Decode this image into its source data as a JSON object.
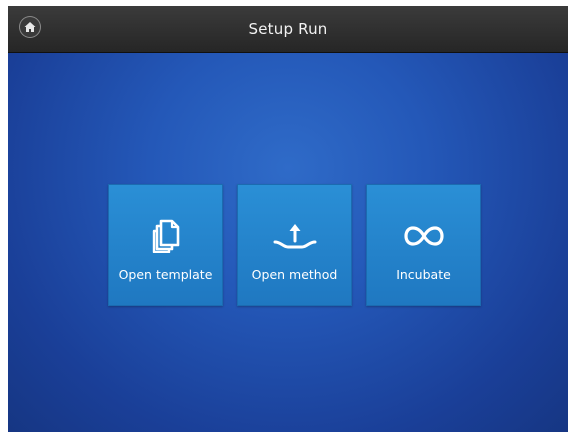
{
  "window": {
    "title": "Setup Run",
    "home_icon": "home-icon"
  },
  "tiles": [
    {
      "label": "Open template",
      "icon": "copy-documents-icon"
    },
    {
      "label": "Open method",
      "icon": "upload-arrow-icon"
    },
    {
      "label": "Incubate",
      "icon": "infinity-icon"
    }
  ],
  "colors": {
    "background": "#1f4aa8",
    "titlebar": "#2e2e2e",
    "tile": "#2284cc",
    "text": "#ffffff"
  }
}
